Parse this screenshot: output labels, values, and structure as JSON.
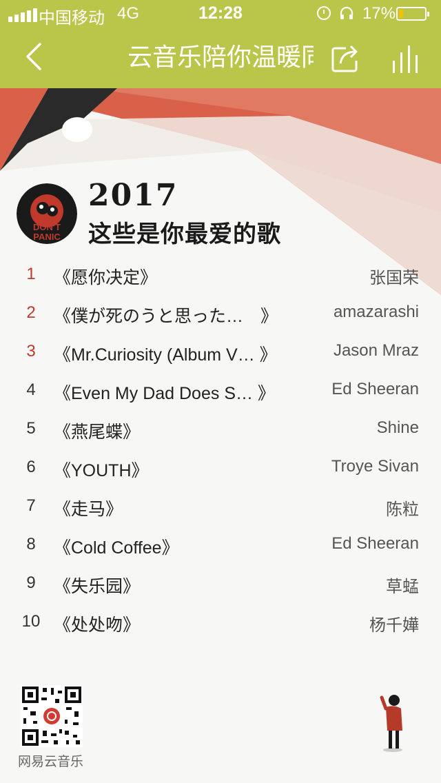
{
  "status_bar": {
    "carrier": "中国移动",
    "network": "4G",
    "time": "12:28",
    "battery_percent": "17%",
    "battery_level": 0.17
  },
  "nav": {
    "title": "云音乐陪你温暖同",
    "back_icon": "chevron-left-icon",
    "share_icon": "share-icon",
    "equalizer_icon": "equalizer-icon"
  },
  "header": {
    "year": "2017",
    "subtitle": "这些是你最爱的歌",
    "avatar_text": "DON'T PANIC"
  },
  "songs": [
    {
      "rank": "1",
      "title": "《愿你决定》",
      "artist": "张国荣"
    },
    {
      "rank": "2",
      "title": "《僕が死のうと思った…　》",
      "artist": "amazarashi"
    },
    {
      "rank": "3",
      "title": "《Mr.Curiosity (Album V… 》",
      "artist": "Jason Mraz"
    },
    {
      "rank": "4",
      "title": "《Even My Dad Does S… 》",
      "artist": "Ed Sheeran"
    },
    {
      "rank": "5",
      "title": "《燕尾蝶》",
      "artist": "Shine"
    },
    {
      "rank": "6",
      "title": "《YOUTH》",
      "artist": "Troye Sivan"
    },
    {
      "rank": "7",
      "title": "《走马》",
      "artist": "陈粒"
    },
    {
      "rank": "8",
      "title": "《Cold Coffee》",
      "artist": "Ed Sheeran"
    },
    {
      "rank": "9",
      "title": "《失乐园》",
      "artist": "草蜢"
    },
    {
      "rank": "10",
      "title": "《处处吻》",
      "artist": "杨千嬅"
    }
  ],
  "footer": {
    "qr_label": "网易云音乐"
  },
  "colors": {
    "accent": "#b9c64a",
    "top_rank": "#c0392b",
    "stage_red": "#d9614a"
  }
}
